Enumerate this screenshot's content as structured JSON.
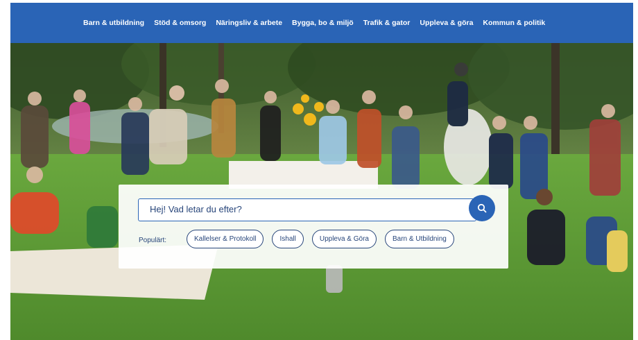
{
  "nav": {
    "items": [
      {
        "label": "Barn & utbildning"
      },
      {
        "label": "Stöd & omsorg"
      },
      {
        "label": "Näringsliv & arbete"
      },
      {
        "label": "Bygga, bo & miljö"
      },
      {
        "label": "Trafik & gator"
      },
      {
        "label": "Uppleva & göra"
      },
      {
        "label": "Kommun & politik"
      }
    ]
  },
  "search": {
    "placeholder": "Hej! Vad letar du efter?",
    "button_icon": "search-icon"
  },
  "popular": {
    "label": "Populärt:",
    "chips": [
      {
        "label": "Kallelser & Protokoll"
      },
      {
        "label": "Ishall"
      },
      {
        "label": "Uppleva & Göra"
      },
      {
        "label": "Barn & Utbildning"
      }
    ]
  },
  "colors": {
    "nav_bg": "#2a64b6",
    "accent": "#2a64b6",
    "text_dark_blue": "#27457a",
    "grass": "#5e9a3a"
  }
}
